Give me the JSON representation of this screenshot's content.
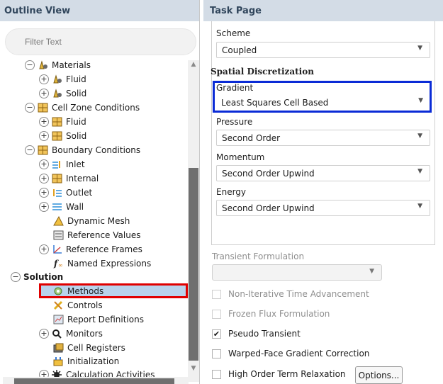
{
  "outline": {
    "title": "Outline View",
    "filter_placeholder": "Filter Text",
    "items": [
      {
        "label": "Materials",
        "exp": "−",
        "icon": "materials-icon"
      },
      {
        "label": "Fluid",
        "exp": "+",
        "icon": "materials-icon"
      },
      {
        "label": "Solid",
        "exp": "+",
        "icon": "materials-icon"
      },
      {
        "label": "Cell Zone Conditions",
        "exp": "−",
        "icon": "grid-icon"
      },
      {
        "label": "Fluid",
        "exp": "+",
        "icon": "grid-icon"
      },
      {
        "label": "Solid",
        "exp": "+",
        "icon": "grid-icon"
      },
      {
        "label": "Boundary Conditions",
        "exp": "−",
        "icon": "grid-icon"
      },
      {
        "label": "Inlet",
        "exp": "+",
        "icon": "inlet-icon"
      },
      {
        "label": "Internal",
        "exp": "+",
        "icon": "grid-icon"
      },
      {
        "label": "Outlet",
        "exp": "+",
        "icon": "outlet-icon"
      },
      {
        "label": "Wall",
        "exp": "+",
        "icon": "wall-icon"
      },
      {
        "label": "Dynamic Mesh",
        "exp": "",
        "icon": "dynamic-mesh-icon"
      },
      {
        "label": "Reference Values",
        "exp": "",
        "icon": "reference-values-icon"
      },
      {
        "label": "Reference Frames",
        "exp": "+",
        "icon": "reference-frames-icon"
      },
      {
        "label": "Named Expressions",
        "exp": "",
        "icon": "named-expressions-icon"
      },
      {
        "label": "Solution",
        "exp": "−",
        "icon": ""
      },
      {
        "label": "Methods",
        "exp": "",
        "icon": "methods-icon"
      },
      {
        "label": "Controls",
        "exp": "",
        "icon": "controls-icon"
      },
      {
        "label": "Report Definitions",
        "exp": "",
        "icon": "report-definitions-icon"
      },
      {
        "label": "Monitors",
        "exp": "+",
        "icon": "monitors-icon"
      },
      {
        "label": "Cell Registers",
        "exp": "",
        "icon": "cell-registers-icon"
      },
      {
        "label": "Initialization",
        "exp": "",
        "icon": "initialization-icon"
      },
      {
        "label": "Calculation Activities",
        "exp": "+",
        "icon": "calculation-activities-icon"
      }
    ]
  },
  "task": {
    "title": "Task Page",
    "scheme_label": "Scheme",
    "scheme_value": "Coupled",
    "spatial_title": "Spatial Discretization",
    "gradient_label": "Gradient",
    "gradient_value": "Least Squares Cell Based",
    "pressure_label": "Pressure",
    "pressure_value": "Second Order",
    "momentum_label": "Momentum",
    "momentum_value": "Second Order Upwind",
    "energy_label": "Energy",
    "energy_value": "Second Order Upwind",
    "transient_label": "Transient Formulation",
    "transient_value": "",
    "checkboxes": [
      {
        "label": "Non-Iterative Time Advancement",
        "checked": false,
        "enabled": false
      },
      {
        "label": "Frozen Flux Formulation",
        "checked": false,
        "enabled": false
      },
      {
        "label": "Pseudo Transient",
        "checked": true,
        "enabled": true
      },
      {
        "label": "Warped-Face Gradient Correction",
        "checked": false,
        "enabled": true
      },
      {
        "label": "High Order Term Relaxation",
        "checked": false,
        "enabled": true
      }
    ],
    "options_button": "Options...",
    "dropdown_arrow": "▼",
    "check_mark": "✔"
  },
  "colors": {
    "header_bg": "#d3dce6",
    "selection": "#b9d3ec",
    "highlight_red": "#e00000",
    "highlight_blue": "#0a2bd6"
  }
}
